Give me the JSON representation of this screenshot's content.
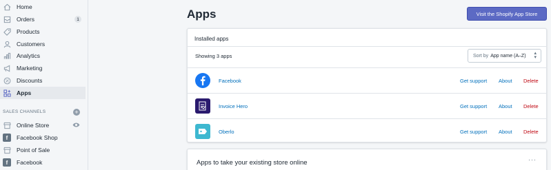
{
  "sidebar": {
    "items": [
      {
        "label": "Home",
        "icon": "home-icon"
      },
      {
        "label": "Orders",
        "icon": "orders-icon",
        "badge": "1"
      },
      {
        "label": "Products",
        "icon": "products-icon"
      },
      {
        "label": "Customers",
        "icon": "customers-icon"
      },
      {
        "label": "Analytics",
        "icon": "analytics-icon"
      },
      {
        "label": "Marketing",
        "icon": "marketing-icon"
      },
      {
        "label": "Discounts",
        "icon": "discounts-icon"
      },
      {
        "label": "Apps",
        "icon": "apps-icon",
        "active": true
      }
    ],
    "sales_channels_title": "SALES CHANNELS",
    "channels": [
      {
        "label": "Online Store"
      },
      {
        "label": "Facebook Shop"
      },
      {
        "label": "Point of Sale"
      },
      {
        "label": "Facebook"
      }
    ]
  },
  "header": {
    "title": "Apps",
    "visit_store_button": "Visit the Shopify App Store"
  },
  "installed": {
    "title": "Installed apps",
    "count_text": "Showing 3 apps",
    "sort_label": "Sort by",
    "sort_value": "App name (A–Z)",
    "apps": [
      {
        "name": "Facebook",
        "get_support": "Get support",
        "about": "About",
        "delete": "Delete"
      },
      {
        "name": "Invoice Hero",
        "get_support": "Get support",
        "about": "About",
        "delete": "Delete"
      },
      {
        "name": "Oberlo",
        "get_support": "Get support",
        "about": "About",
        "delete": "Delete"
      }
    ]
  },
  "online_card": {
    "title": "Apps to take your existing store online",
    "more": "···"
  },
  "colors": {
    "accent": "#5c6ac4",
    "link": "#006fbb",
    "destructive": "#bf0711"
  }
}
